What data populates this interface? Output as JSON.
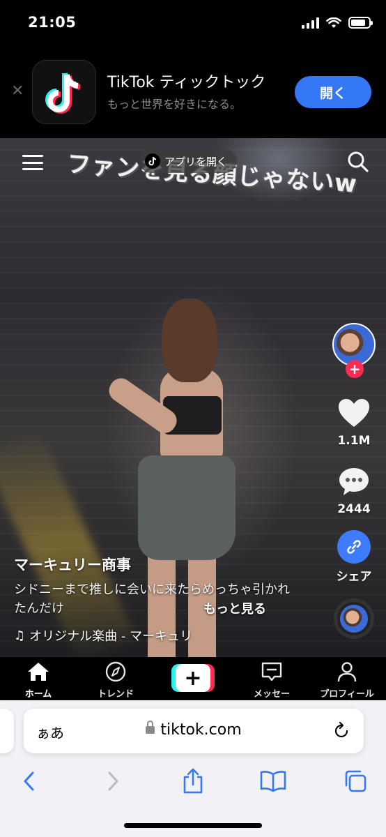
{
  "status_bar": {
    "time": "21:05",
    "battery_level": 0.85
  },
  "app_banner": {
    "close_icon": "close-icon",
    "app_name": "TikTok ティックトック",
    "tagline": "もっと世界を好きになる。",
    "open_label": "開く"
  },
  "video": {
    "caption_overlay": "ファンを見る顔じゃないw",
    "open_app_label": "アプリを開く",
    "author": "マーキュリー商事",
    "description": "シドニーまで推しに会いに来たらめっちゃ引かれたんだけ",
    "more_label": "もっと見る",
    "music": "オリジナル楽曲 - マーキュリ"
  },
  "rail": {
    "likes": "1.1M",
    "comments": "2444",
    "share_label": "シェア"
  },
  "bottom_nav": {
    "items": [
      {
        "label": "ホーム",
        "icon": "home-icon"
      },
      {
        "label": "トレンド",
        "icon": "compass-icon"
      },
      {
        "label": "",
        "icon": "plus-icon"
      },
      {
        "label": "メッセー",
        "icon": "inbox-icon"
      },
      {
        "label": "プロフィール",
        "icon": "person-icon"
      }
    ]
  },
  "safari": {
    "aa_label": "ぁあ",
    "url": "tiktok.com"
  },
  "colors": {
    "tiktok_red": "#fe2c55",
    "tiktok_cyan": "#25f4ee",
    "ios_blue": "#3478f6"
  }
}
